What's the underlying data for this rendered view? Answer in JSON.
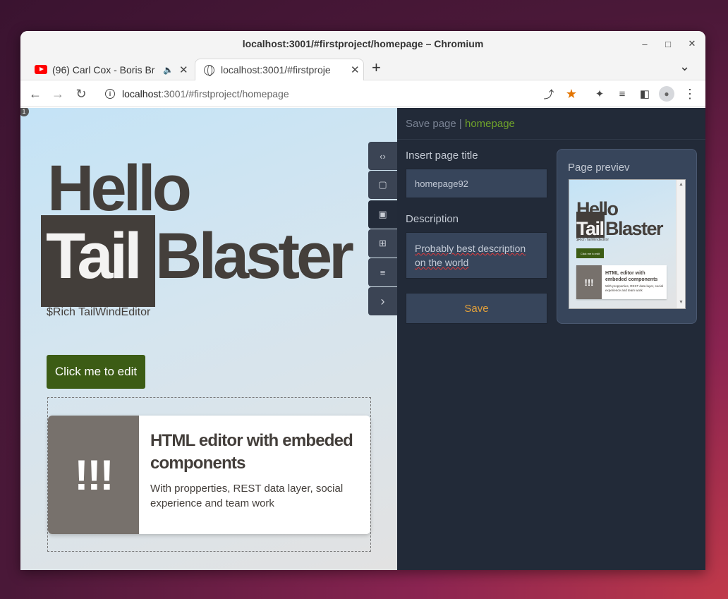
{
  "window": {
    "title": "localhost:3001/#firstproject/homepage – Chromium",
    "controls": {
      "minimize": "–",
      "maximize": "□",
      "close": "✕"
    }
  },
  "tabs": [
    {
      "label": "(96) Carl Cox - Boris Br",
      "icon": "youtube-icon",
      "audio": "🔈",
      "close": "✕"
    },
    {
      "label": "localhost:3001/#firstproje",
      "icon": "globe-icon",
      "close": "✕"
    }
  ],
  "tabbar": {
    "new_tab": "+",
    "tab_search": "⌄"
  },
  "nav": {
    "back": "←",
    "forward": "→",
    "reload": "↻"
  },
  "address": {
    "info": "i",
    "host": "localhost",
    "path": ":3001/#firstproject/homepage"
  },
  "toolbar_icons": {
    "share": "⤴",
    "bookmark": "★",
    "extensions": "✦",
    "media": "≡",
    "sidepanel": "◧",
    "profile": "●",
    "menu": "⋮"
  },
  "canvas": {
    "badge": "1",
    "hero_line1": "Hello",
    "hero_word_highlight": "Tail",
    "hero_word_rest": "Blaster",
    "subtitle": "$Rich TailWindEditor",
    "button_label": "Click me to edit",
    "card": {
      "image_text": "!!!",
      "title": "HTML editor with embeded components",
      "text": "With propperties, REST data layer, social experience and team work"
    }
  },
  "tools": [
    {
      "icon": "code-icon",
      "glyph": "‹›",
      "active": false
    },
    {
      "icon": "file-icon",
      "glyph": "▢",
      "active": false
    },
    {
      "icon": "save-icon",
      "glyph": "▣",
      "active": true
    },
    {
      "icon": "grid-icon",
      "glyph": "⊞",
      "active": false
    },
    {
      "icon": "database-icon",
      "glyph": "≡",
      "active": false
    },
    {
      "icon": "chevron-right-icon",
      "glyph": "›",
      "active": false
    }
  ],
  "panel": {
    "breadcrumb_action": "Save page",
    "breadcrumb_sep": "|",
    "breadcrumb_page": "homepage",
    "title_label": "Insert page title",
    "title_value": "homepage92",
    "description_label": "Description",
    "description_value": "Probably best description on the world",
    "save_label": "Save",
    "preview_label": "Page previev"
  },
  "preview": {
    "hello": "Hello",
    "tail": "Tail",
    "blaster": "Blaster",
    "rich": "$Rich TailWindEditor",
    "button": "Click me to edit",
    "card_img": "!!!",
    "card_title": "HTML editor with embeded components",
    "card_text": "With propperties, REST data layer, social experience and team work",
    "scroll_up": "▲",
    "scroll_down": "▼"
  },
  "colors": {
    "accent_green": "#3c5c15",
    "breadcrumb_page": "#6fa22a",
    "save_text": "#e2a03a",
    "panel_bg": "#222a38"
  }
}
